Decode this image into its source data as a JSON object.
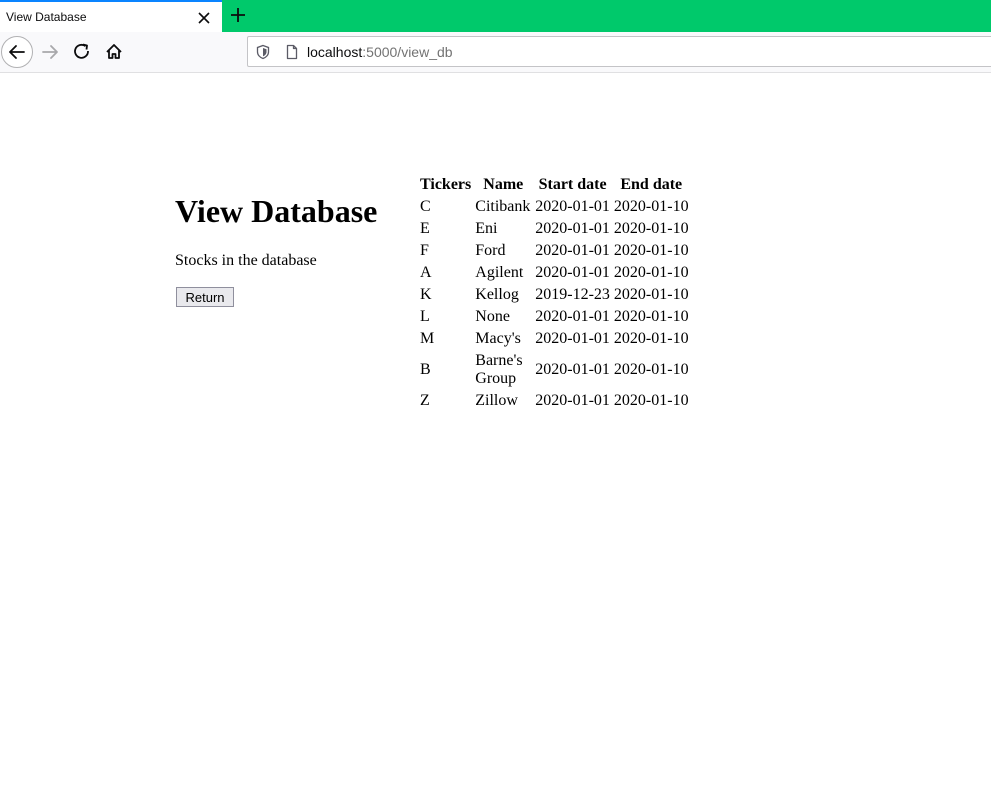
{
  "browser": {
    "tab_title": "View Database",
    "url_host": "localhost",
    "url_path": ":5000/view_db",
    "accent_color": "#00c96b"
  },
  "page": {
    "title": "View Database",
    "subtitle": "Stocks in the database",
    "return_label": "Return"
  },
  "table": {
    "headers": [
      "Tickers",
      "Name",
      "Start date",
      "End date"
    ],
    "rows": [
      {
        "ticker": "C",
        "name": "Citibank",
        "start": "2020-01-01",
        "end": "2020-01-10"
      },
      {
        "ticker": "E",
        "name": "Eni",
        "start": "2020-01-01",
        "end": "2020-01-10"
      },
      {
        "ticker": "F",
        "name": "Ford",
        "start": "2020-01-01",
        "end": "2020-01-10"
      },
      {
        "ticker": "A",
        "name": "Agilent",
        "start": "2020-01-01",
        "end": "2020-01-10"
      },
      {
        "ticker": "K",
        "name": "Kellog",
        "start": "2019-12-23",
        "end": "2020-01-10"
      },
      {
        "ticker": "L",
        "name": "None",
        "start": "2020-01-01",
        "end": "2020-01-10"
      },
      {
        "ticker": "M",
        "name": "Macy's",
        "start": "2020-01-01",
        "end": "2020-01-10"
      },
      {
        "ticker": "B",
        "name": "Barne's Group",
        "start": "2020-01-01",
        "end": "2020-01-10"
      },
      {
        "ticker": "Z",
        "name": "Zillow",
        "start": "2020-01-01",
        "end": "2020-01-10"
      }
    ]
  }
}
